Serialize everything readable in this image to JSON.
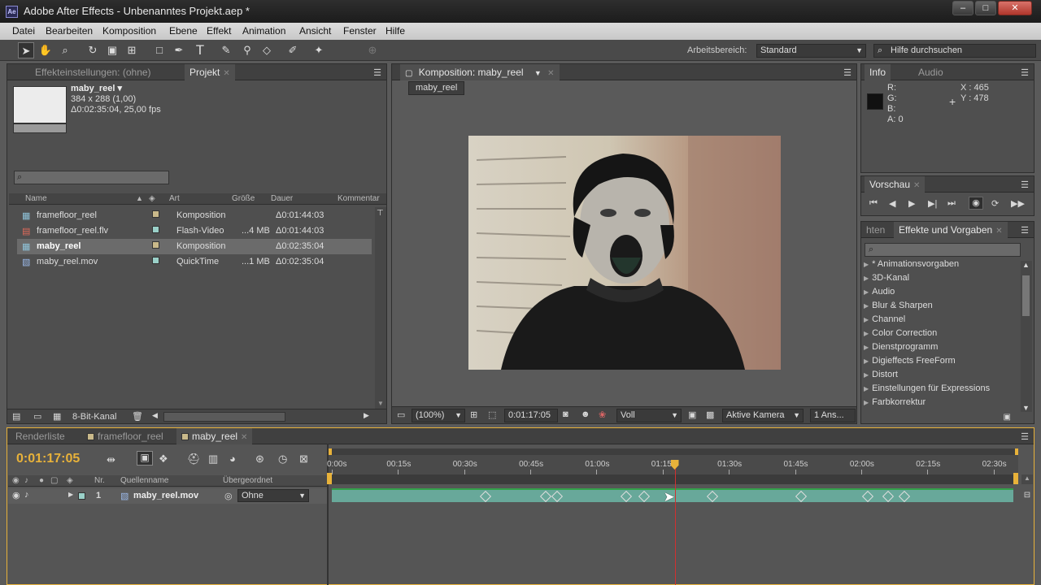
{
  "window": {
    "title": "Adobe After Effects - Unbenanntes Projekt.aep *",
    "logo": "Ae",
    "min": "–",
    "max": "□",
    "close": "✕"
  },
  "menu": [
    "Datei",
    "Bearbeiten",
    "Komposition",
    "Ebene",
    "Effekt",
    "Animation",
    "Ansicht",
    "Fenster",
    "Hilfe"
  ],
  "toolbar": {
    "workspace_label": "Arbeitsbereich:",
    "workspace_value": "Standard",
    "search_placeholder": "Hilfe durchsuchen"
  },
  "project_panel": {
    "tabs": [
      {
        "label": "Effekteinstellungen: (ohne)"
      },
      {
        "label": "Projekt",
        "close": "✕"
      }
    ],
    "preview": {
      "name": "maby_reel ▾",
      "size": "384 x 288 (1,00)",
      "info": "Δ0:02:35:04, 25,00 fps"
    },
    "columns": [
      "Name",
      "Art",
      "Größe",
      "Dauer",
      "Kommentar"
    ],
    "items": [
      {
        "name": "framefloor_reel",
        "type": "Komposition",
        "size": "",
        "duration": "Δ0:01:44:03",
        "color": "#c9b98a"
      },
      {
        "name": "framefloor_reel.flv",
        "type": "Flash-Video",
        "size": "...4 MB",
        "duration": "Δ0:01:44:03",
        "color": "#9ad0c8"
      },
      {
        "name": "maby_reel",
        "type": "Komposition",
        "size": "",
        "duration": "Δ0:02:35:04",
        "color": "#c9b98a"
      },
      {
        "name": "maby_reel.mov",
        "type": "QuickTime",
        "size": "...1 MB",
        "duration": "Δ0:02:35:04",
        "color": "#9ad0c8"
      }
    ],
    "footer_label": "8-Bit-Kanal"
  },
  "comp_panel": {
    "tab": "Komposition: maby_reel",
    "close": "✕",
    "crumb": "maby_reel",
    "zoom": "(100%)",
    "timecode": "0:01:17:05",
    "resolution": "Voll",
    "camera": "Aktive Kamera",
    "views": "1 Ans..."
  },
  "info_panel": {
    "tabs": [
      "Info",
      "Audio"
    ],
    "r": "R:",
    "g": "G:",
    "b": "B:",
    "a": "A:  0",
    "x": "X : 465",
    "y": "Y : 478"
  },
  "preview_panel": {
    "tab": "Vorschau",
    "close": "✕"
  },
  "effects_panel": {
    "tab_prev": "hten",
    "tab": "Effekte und Vorgaben",
    "close": "✕",
    "items": [
      "* Animationsvorgaben",
      "3D-Kanal",
      "Audio",
      "Blur & Sharpen",
      "Channel",
      "Color Correction",
      "Dienstprogramm",
      "Digieffects FreeForm",
      "Distort",
      "Einstellungen für Expressions",
      "Farbkorrektur"
    ]
  },
  "timeline": {
    "tabs": [
      {
        "label": "Renderliste"
      },
      {
        "label": "framefloor_reel"
      },
      {
        "label": "maby_reel",
        "close": "✕"
      }
    ],
    "timecode": "0:01:17:05",
    "col_nr": "Nr.",
    "col_source": "Quellenname",
    "col_parent": "Übergeordnet",
    "layer": {
      "nr": "1",
      "name": "maby_reel.mov",
      "parent": "Ohne"
    },
    "ticks": [
      "0:00s",
      "00:15s",
      "00:30s",
      "00:45s",
      "01:00s",
      "01:15s",
      "01:30s",
      "01:45s",
      "02:00s",
      "02:15s",
      "02:30s"
    ],
    "current_time_fraction": 0.503,
    "keyframe_fractions": [
      0.226,
      0.314,
      0.331,
      0.432,
      0.458,
      0.558,
      0.689,
      0.786,
      0.816,
      0.84
    ]
  },
  "colors": {
    "accent": "#e8b23a",
    "layer_bar": "#68a89a",
    "playhead": "#d03030"
  }
}
